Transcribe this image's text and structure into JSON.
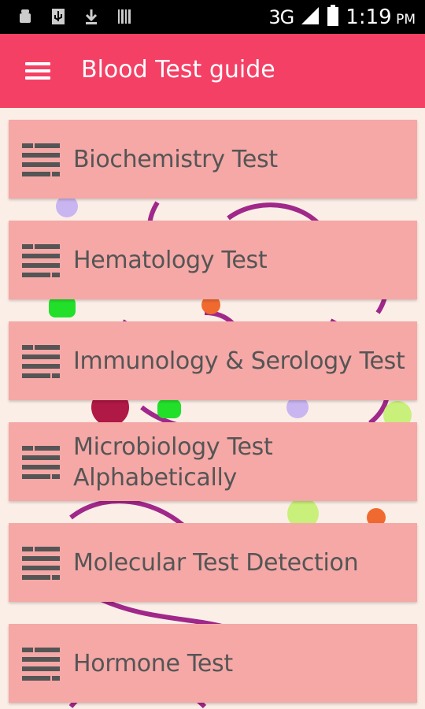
{
  "status_bar": {
    "network": "3G",
    "time": "1:19",
    "ampm": "PM",
    "icons": [
      "android-debug-icon",
      "usb-icon",
      "download-icon",
      "barcode-icon",
      "signal-icon",
      "battery-icon"
    ]
  },
  "app_bar": {
    "title": "Blood Test guide",
    "menu_icon": "hamburger-menu-icon"
  },
  "menu": {
    "items": [
      {
        "label": "Biochemistry Test",
        "icon": "list-icon"
      },
      {
        "label": "Hematology Test",
        "icon": "list-icon"
      },
      {
        "label": "Immunology & Serology Test",
        "icon": "list-icon"
      },
      {
        "label": "Microbiology Test Alphabetically",
        "line1": "Microbiology Test",
        "line2": "Alphabetically",
        "icon": "list-icon"
      },
      {
        "label": "Molecular Test Detection",
        "icon": "list-icon"
      },
      {
        "label": "Hormone Test",
        "icon": "list-icon"
      }
    ]
  },
  "colors": {
    "app_bar": "#f44065",
    "card": "#f5a8a6",
    "text": "#555555",
    "background": "#fbeee6"
  }
}
